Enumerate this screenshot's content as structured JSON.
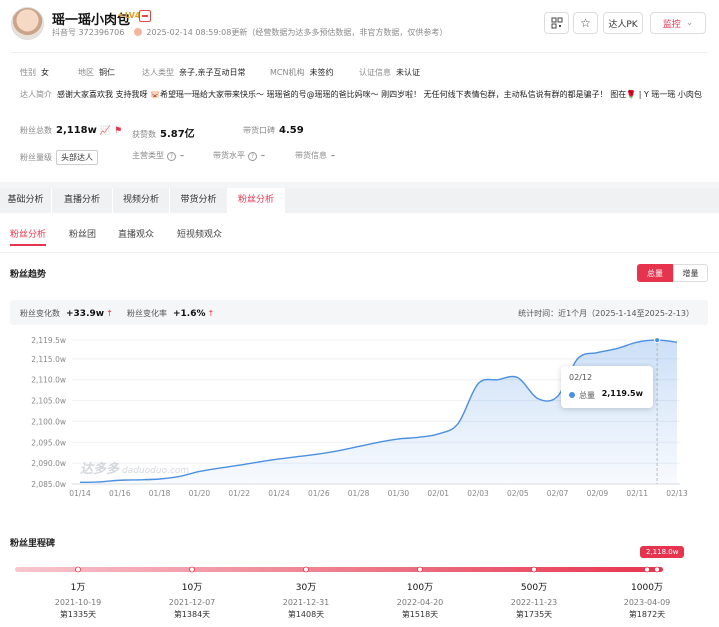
{
  "profile": {
    "name": "瑶一瑶小肉包",
    "level_badge": "LV4",
    "id_label": "抖音号",
    "id_value": "372396706",
    "update_text": "2025-02-14 08:59:08更新（经营数据为达多多预估数据，非官方数据，仅供参考）"
  },
  "actions": {
    "pk": "达人PK",
    "monitor": "监控"
  },
  "info": {
    "gender_label": "性别",
    "gender": "女",
    "region_label": "地区",
    "region": "铜仁",
    "category_label": "达人类型",
    "category": "亲子,亲子互动日常",
    "mcn_label": "MCN机构",
    "mcn": "未签约",
    "cert_label": "认证信息",
    "cert": "未认证",
    "intro_label": "达人简介",
    "intro": "感谢大家喜欢我 支持我呀 🐷希望瑶一瑶给大家带来快乐～ 瑶瑶爸的号@瑶瑶的爸比妈咪～ 刚四岁啦！ 无任何线下表情包群，主动私信说有群的都是骗子！ 图在🌹 | Y 瑶一瑶 小肉包"
  },
  "stats": {
    "fans_label": "粉丝总数",
    "fans": "2,118w",
    "likes_label": "获赞数",
    "likes": "5.87亿",
    "reputation_label": "带货口碑",
    "reputation": "4.59",
    "fan_level_label": "粉丝量级",
    "fan_level": "头部达人",
    "main_type_label": "主营类型",
    "main_type": "–",
    "sales_level_label": "带货水平",
    "sales_level": "–",
    "sales_info_label": "带货信息",
    "sales_info": "–"
  },
  "tabs": [
    "基础分析",
    "直播分析",
    "视频分析",
    "带货分析",
    "粉丝分析"
  ],
  "subtabs": [
    "粉丝分析",
    "粉丝团",
    "直播观众",
    "短视频观众"
  ],
  "trend": {
    "title": "粉丝趋势",
    "toggle_total": "总量",
    "toggle_incr": "增量",
    "change_label": "粉丝变化数",
    "change": "+33.9w",
    "rate_label": "粉丝变化率",
    "rate": "+1.6%",
    "period": "统计时间：近1个月（2025-1-14至2025-2-13）",
    "tooltip_date": "02/12",
    "tooltip_key": "总量",
    "tooltip_value": "2,119.5w",
    "watermark": "达多多",
    "watermark_url": "daduoduo.com",
    "up_arrow": "↑"
  },
  "chart_data": {
    "type": "area",
    "ylim": [
      2085,
      2120
    ],
    "y_unit": "w",
    "yticks": [
      "2,085.0w",
      "2,090.0w",
      "2,095.0w",
      "2,100.0w",
      "2,105.0w",
      "2,110.0w",
      "2,115.0w",
      "2,119.5w"
    ],
    "yticks_values": [
      2085,
      2090,
      2095,
      2100,
      2105,
      2110,
      2115,
      2119.5
    ],
    "xticks": [
      "01/14",
      "01/16",
      "01/18",
      "01/20",
      "01/22",
      "01/24",
      "01/26",
      "01/28",
      "01/30",
      "02/01",
      "02/03",
      "02/05",
      "02/07",
      "02/09",
      "02/11",
      "02/13"
    ],
    "x": [
      "01/14",
      "01/15",
      "01/16",
      "01/17",
      "01/18",
      "01/19",
      "01/20",
      "01/21",
      "01/22",
      "01/23",
      "01/24",
      "01/25",
      "01/26",
      "01/27",
      "01/28",
      "01/29",
      "01/30",
      "01/31",
      "02/01",
      "02/02",
      "02/03",
      "02/04",
      "02/05",
      "02/06",
      "02/07",
      "02/08",
      "02/09",
      "02/10",
      "02/11",
      "02/12",
      "02/13"
    ],
    "series": [
      {
        "values": [
          2085.4,
          2085.5,
          2085.9,
          2086.0,
          2086.2,
          2086.8,
          2088.0,
          2088.8,
          2089.5,
          2090.3,
          2091.0,
          2091.6,
          2092.2,
          2093.0,
          2094.0,
          2095.0,
          2095.8,
          2096.2,
          2097.0,
          2099.5,
          2109.0,
          2110.0,
          2110.5,
          2105.5,
          2106.0,
          2115.0,
          2116.5,
          2117.5,
          2119.0,
          2119.5,
          2119.0
        ]
      }
    ]
  },
  "milestones": {
    "title": "粉丝里程碑",
    "current": "2,118.0w",
    "items": [
      {
        "label": "1万",
        "date": "2021-10-19",
        "days": "第1335天"
      },
      {
        "label": "10万",
        "date": "2021-12-07",
        "days": "第1384天"
      },
      {
        "label": "30万",
        "date": "2021-12-31",
        "days": "第1408天"
      },
      {
        "label": "100万",
        "date": "2022-04-20",
        "days": "第1518天"
      },
      {
        "label": "500万",
        "date": "2022-11-23",
        "days": "第1735天"
      },
      {
        "label": "1000万",
        "date": "2023-04-09",
        "days": "第1872天"
      }
    ]
  }
}
